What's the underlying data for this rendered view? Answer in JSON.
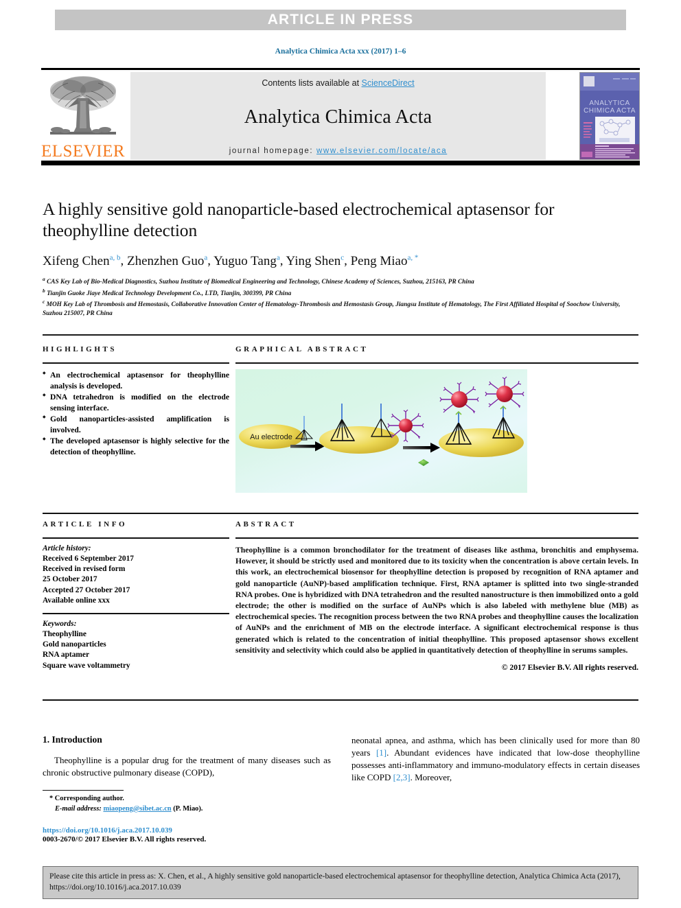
{
  "banner": {
    "text": "ARTICLE IN PRESS"
  },
  "running_head": "Analytica Chimica Acta xxx (2017) 1–6",
  "masthead": {
    "contents_prefix": "Contents lists available at ",
    "sciencedirect": "ScienceDirect",
    "journal_title": "Analytica Chimica Acta",
    "homepage_label": "journal homepage:",
    "homepage_url": "www.elsevier.com/locate/aca",
    "publisher": "ELSEVIER",
    "cover_title_line1": "ANALYTICA",
    "cover_title_line2": "CHIMICA ACTA"
  },
  "article": {
    "title": "A highly sensitive gold nanoparticle-based electrochemical aptasensor for theophylline detection",
    "authors": [
      {
        "name": "Xifeng Chen",
        "marks": "a, b"
      },
      {
        "name": "Zhenzhen Guo",
        "marks": "a"
      },
      {
        "name": "Yuguo Tang",
        "marks": "a"
      },
      {
        "name": "Ying Shen",
        "marks": "c"
      },
      {
        "name": "Peng Miao",
        "marks": "a, *"
      }
    ],
    "affiliations": [
      {
        "mark": "a",
        "text": "CAS Key Lab of Bio-Medical Diagnostics, Suzhou Institute of Biomedical Engineering and Technology, Chinese Academy of Sciences, Suzhou, 215163, PR China"
      },
      {
        "mark": "b",
        "text": "Tianjin Guoke Jiaye Medical Technology Development Co., LTD, Tianjin, 300399, PR China"
      },
      {
        "mark": "c",
        "text": "MOH Key Lab of Thrombosis and Hemostasis, Collaborative Innovation Center of Hematology-Thrombosis and Hemostasis Group, Jiangsu Institute of Hematology, The First Affiliated Hospital of Soochow University, Suzhou 215007, PR China"
      }
    ]
  },
  "highlights": {
    "heading": "HIGHLIGHTS",
    "items": [
      "An electrochemical aptasensor for theophylline analysis is developed.",
      "DNA tetrahedron is modified on the electrode sensing interface.",
      "Gold nanoparticles-assisted amplification is involved.",
      "The developed aptasensor is highly selective for the detection of theophylline."
    ]
  },
  "graphical_abstract": {
    "heading": "GRAPHICAL ABSTRACT",
    "figure_label": "Au electrode"
  },
  "article_info": {
    "heading": "ARTICLE INFO",
    "history_label": "Article history:",
    "history": [
      "Received 6 September 2017",
      "Received in revised form",
      "25 October 2017",
      "Accepted 27 October 2017",
      "Available online xxx"
    ],
    "keywords_label": "Keywords:",
    "keywords": [
      "Theophylline",
      "Gold nanoparticles",
      "RNA aptamer",
      "Square wave voltammetry"
    ]
  },
  "abstract": {
    "heading": "ABSTRACT",
    "text": "Theophylline is a common bronchodilator for the treatment of diseases like asthma, bronchitis and emphysema. However, it should be strictly used and monitored due to its toxicity when the concentration is above certain levels. In this work, an electrochemical biosensor for theophylline detection is proposed by recognition of RNA aptamer and gold nanoparticle (AuNP)-based amplification technique. First, RNA aptamer is splitted into two single-stranded RNA probes. One is hybridized with DNA tetrahedron and the resulted nanostructure is then immobilized onto a gold electrode; the other is modified on the surface of AuNPs which is also labeled with methylene blue (MB) as electrochemical species. The recognition process between the two RNA probes and theophylline causes the localization of AuNPs and the enrichment of MB on the electrode interface. A significant electrochemical response is thus generated which is related to the concentration of initial theophylline. This proposed aptasensor shows excellent sensitivity and selectivity which could also be applied in quantitatively detection of theophylline in serums samples.",
    "copyright": "© 2017 Elsevier B.V. All rights reserved."
  },
  "body": {
    "section_title": "1. Introduction",
    "left_paragraph": "Theophylline is a popular drug for the treatment of many diseases such as chronic obstructive pulmonary disease (COPD),",
    "right_paragraph_parts": [
      {
        "t": "neonatal apnea, and asthma, which has been clinically used for more than 80 years "
      },
      {
        "t": "[1]",
        "ref": true
      },
      {
        "t": ". Abundant evidences have indicated that low-dose theophylline possesses anti-inflammatory and immuno-modulatory effects in certain diseases like COPD "
      },
      {
        "t": "[2,3]",
        "ref": true
      },
      {
        "t": ". Moreover,"
      }
    ],
    "footnote_star": "* Corresponding author.",
    "footnote_email_label": "E-mail address:",
    "footnote_email": "miaopeng@sibet.ac.cn",
    "footnote_email_suffix": "(P. Miao).",
    "doi": "https://doi.org/10.1016/j.aca.2017.10.039",
    "issn_line": "0003-2670/© 2017 Elsevier B.V. All rights reserved."
  },
  "cite_box": {
    "text": "Please cite this article in press as: X. Chen, et al., A highly sensitive gold nanoparticle-based electrochemical aptasensor for theophylline detection, Analytica Chimica Acta (2017), https://doi.org/10.1016/j.aca.2017.10.039"
  },
  "colors": {
    "link": "#2e8ece",
    "banner_bg": "#c4c4c4",
    "elsevier_orange": "#F47B20",
    "masthead_bg": "#e7e7e7",
    "cite_box_bg": "#c9c9c9",
    "gold": "#e8d14a",
    "nanoparticle_red": "#d42a3a",
    "probe_purple": "#8a2be2"
  }
}
